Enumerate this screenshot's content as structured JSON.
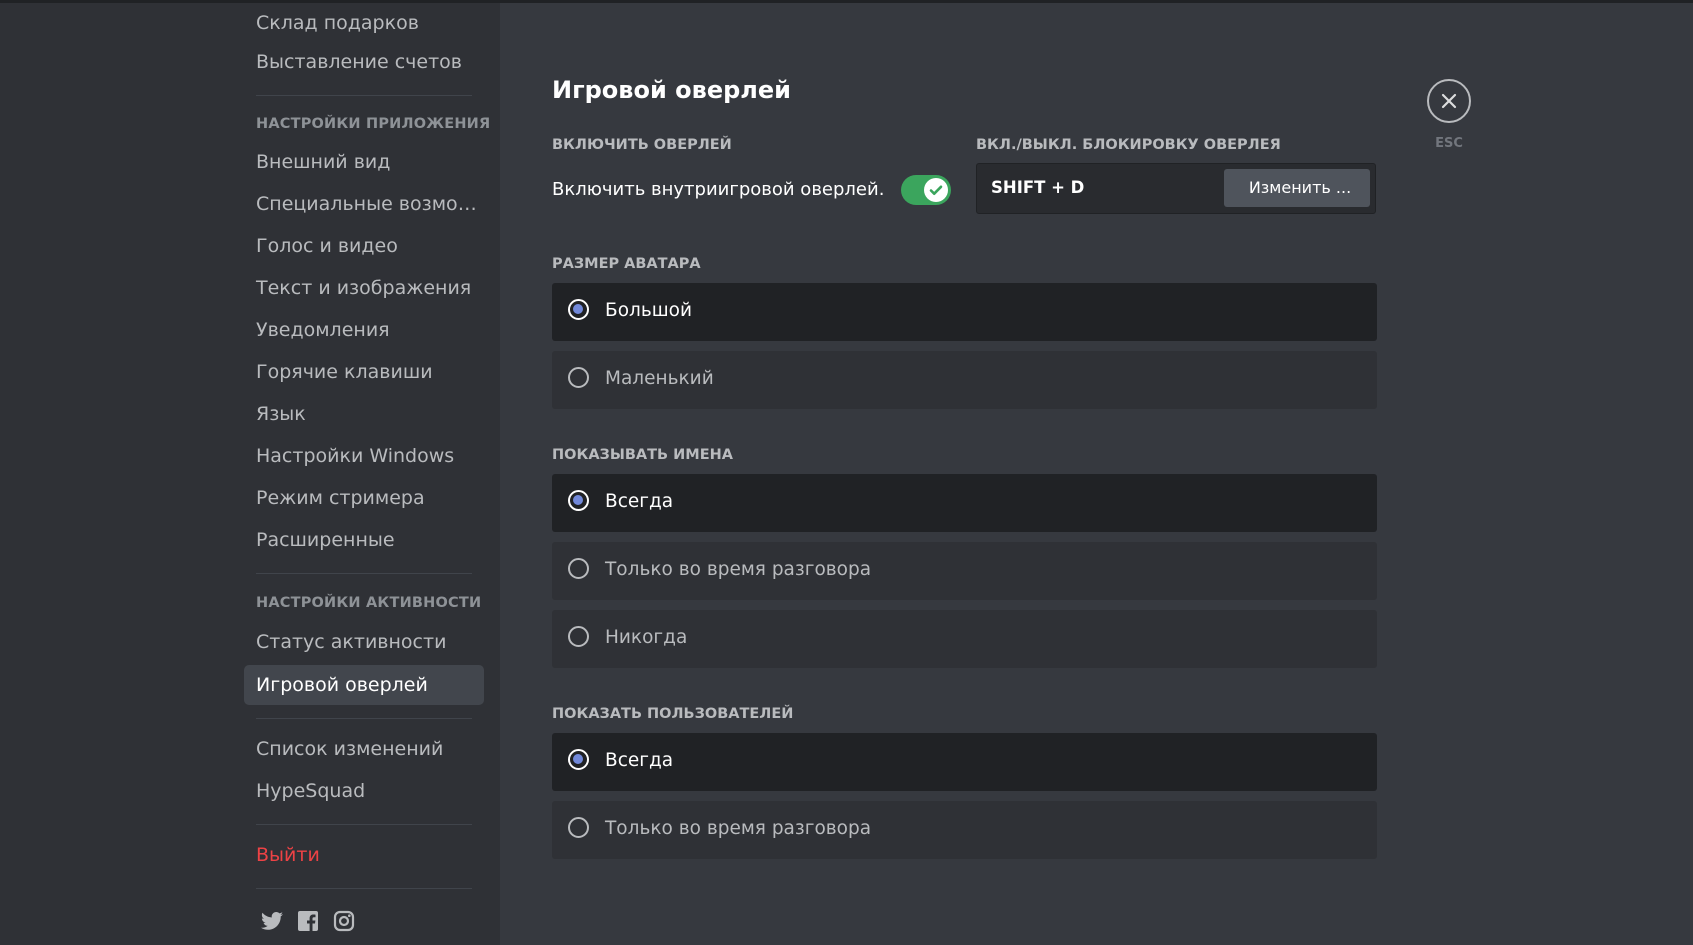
{
  "sidebar": {
    "top_items": [
      "Склад подарков",
      "Выставление счетов"
    ],
    "app_settings_header": "НАСТРОЙКИ ПРИЛОЖЕНИЯ",
    "app_settings_items": [
      "Внешний вид",
      "Специальные возмож...",
      "Голос и видео",
      "Текст и изображения",
      "Уведомления",
      "Горячие клавиши",
      "Язык",
      "Настройки Windows",
      "Режим стримера",
      "Расширенные"
    ],
    "activity_header": "НАСТРОЙКИ АКТИВНОСТИ",
    "activity_items": [
      "Статус активности",
      "Игровой оверлей"
    ],
    "extra_items": [
      "Список изменений",
      "HypeSquad"
    ],
    "logout": "Выйти",
    "socials": [
      "twitter-icon",
      "facebook-icon",
      "instagram-icon"
    ]
  },
  "main": {
    "title": "Игровой оверлей",
    "enable_header": "ВКЛЮЧИТЬ ОВЕРЛЕЙ",
    "enable_text": "Включить внутриигровой оверлей.",
    "enable_on": true,
    "lock_header": "ВКЛ./ВЫКЛ. БЛОКИРОВКУ ОВЕРЛЕЯ",
    "lock_keybind": "SHIFT + D",
    "lock_edit": "Изменить ...",
    "avatar_header": "РАЗМЕР АВАТАРА",
    "avatar_options": [
      "Большой",
      "Маленький"
    ],
    "names_header": "ПОКАЗЫВАТЬ ИМЕНА",
    "names_options": [
      "Всегда",
      "Только во время разговора",
      "Никогда"
    ],
    "users_header": "ПОКАЗАТЬ ПОЛЬЗОВАТЕЛЕЙ",
    "users_options": [
      "Всегда",
      "Только во время разговора"
    ],
    "close_label": "ESC"
  },
  "colors": {
    "accent": "#7289da",
    "toggle_on": "#3ba55d",
    "danger": "#ed4245"
  }
}
